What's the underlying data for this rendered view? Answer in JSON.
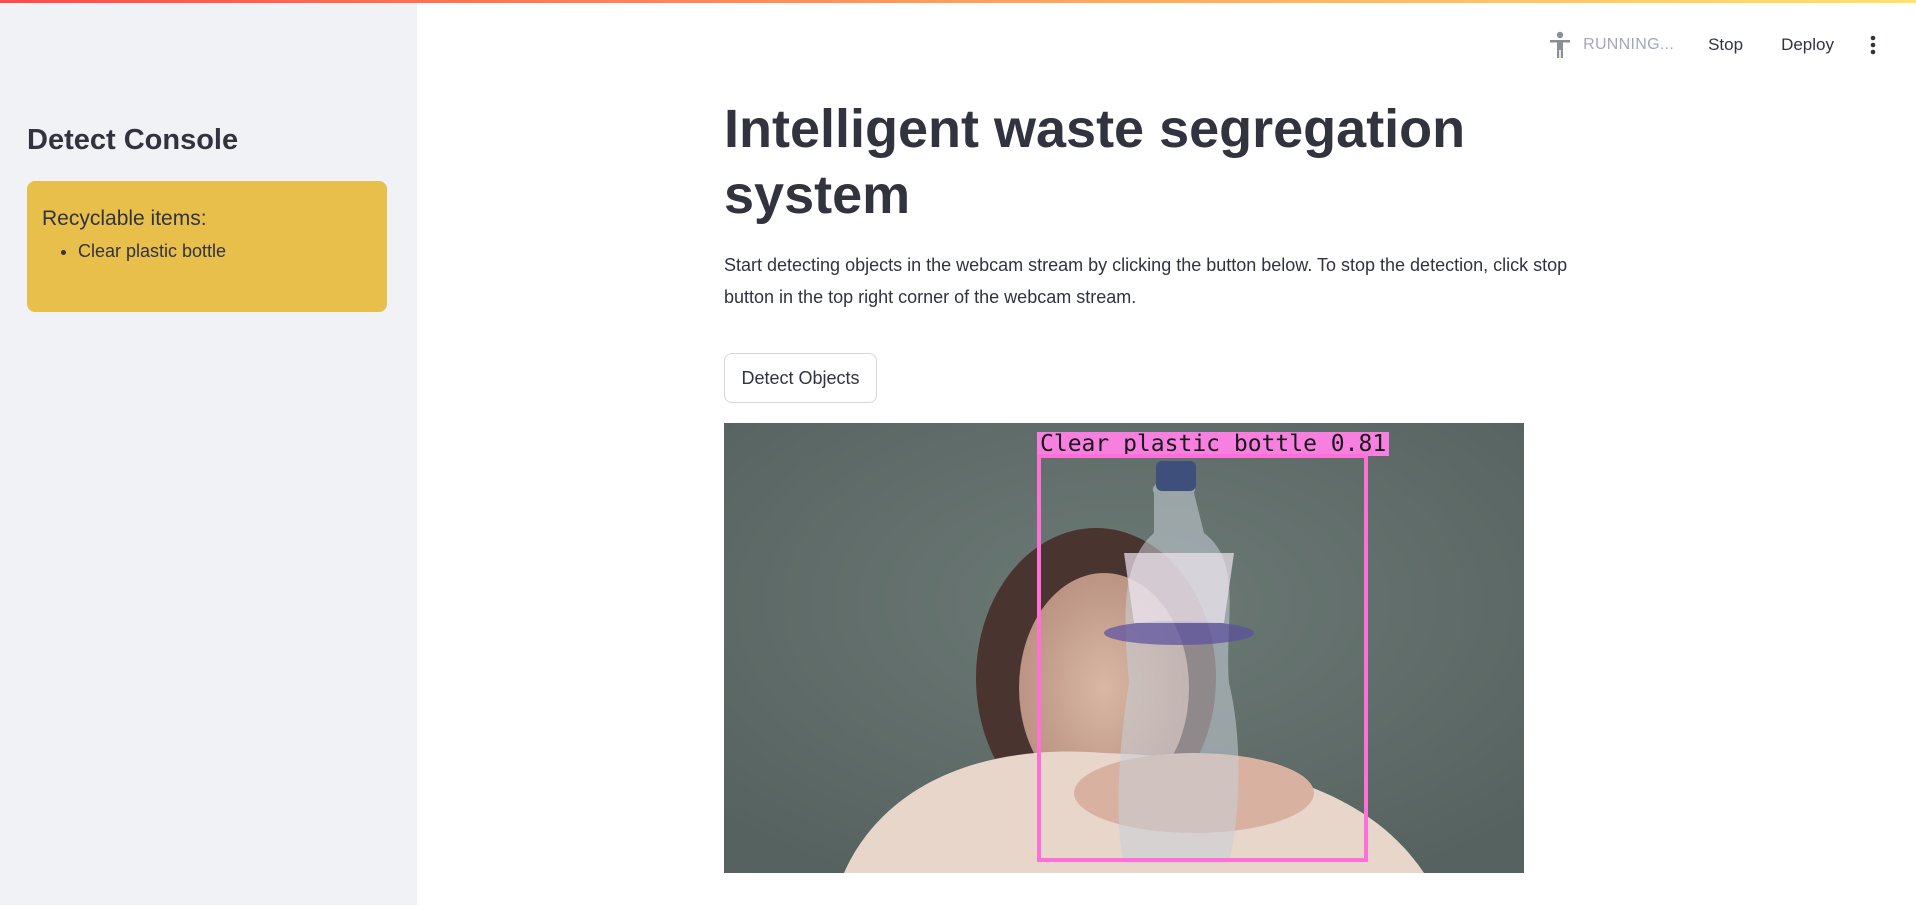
{
  "sidebar": {
    "title": "Detect Console",
    "alert": {
      "heading": "Recyclable items:",
      "items": [
        "Clear plastic bottle"
      ],
      "color": "#e9bf4c"
    }
  },
  "toolbar": {
    "status_icon": "running-person-icon",
    "status_label": "RUNNING...",
    "stop_label": "Stop",
    "deploy_label": "Deploy",
    "menu_icon": "vertical-ellipsis-icon"
  },
  "main": {
    "title": "Intelligent waste segregation system",
    "description": "Start detecting objects in the webcam stream by clicking the button below. To stop the detection, click stop button in the top right corner of the webcam stream.",
    "detect_button_label": "Detect Objects",
    "webcam": {
      "detection_label": "Clear plastic bottle 0.81",
      "box_color": "#ff6fd8"
    }
  },
  "colors": {
    "accent": "#ff4b4b",
    "sidebar_bg": "#f0f2f6",
    "text": "#31333f"
  }
}
